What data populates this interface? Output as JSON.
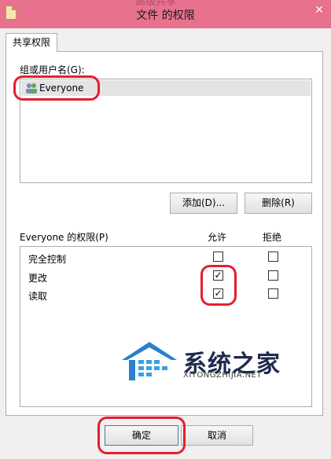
{
  "window": {
    "background_title": "高级共享",
    "title": "文件 的权限",
    "close_symbol": "✕"
  },
  "tabs": [
    {
      "label": "共享权限",
      "selected": true
    }
  ],
  "groups": {
    "label": "组或用户名(G):",
    "items": [
      {
        "name": "Everyone",
        "icon": "users-icon",
        "selected": true
      }
    ]
  },
  "buttons": {
    "add_label": "添加(D)...",
    "remove_label": "删除(R)",
    "ok_label": "确定",
    "cancel_label": "取消"
  },
  "permissions": {
    "label": "Everyone 的权限(P)",
    "allow_header": "允许",
    "deny_header": "拒绝",
    "rows": [
      {
        "name": "完全控制",
        "allow": false,
        "deny": false
      },
      {
        "name": "更改",
        "allow": true,
        "deny": false
      },
      {
        "name": "读取",
        "allow": true,
        "deny": false
      }
    ]
  },
  "watermark": {
    "text": "系统之家",
    "sub": "XITONGZHIJIA.NET"
  },
  "colors": {
    "titlebar": "#e8718e",
    "highlight": "#e81d2f",
    "selection": "#e4e4e4"
  }
}
